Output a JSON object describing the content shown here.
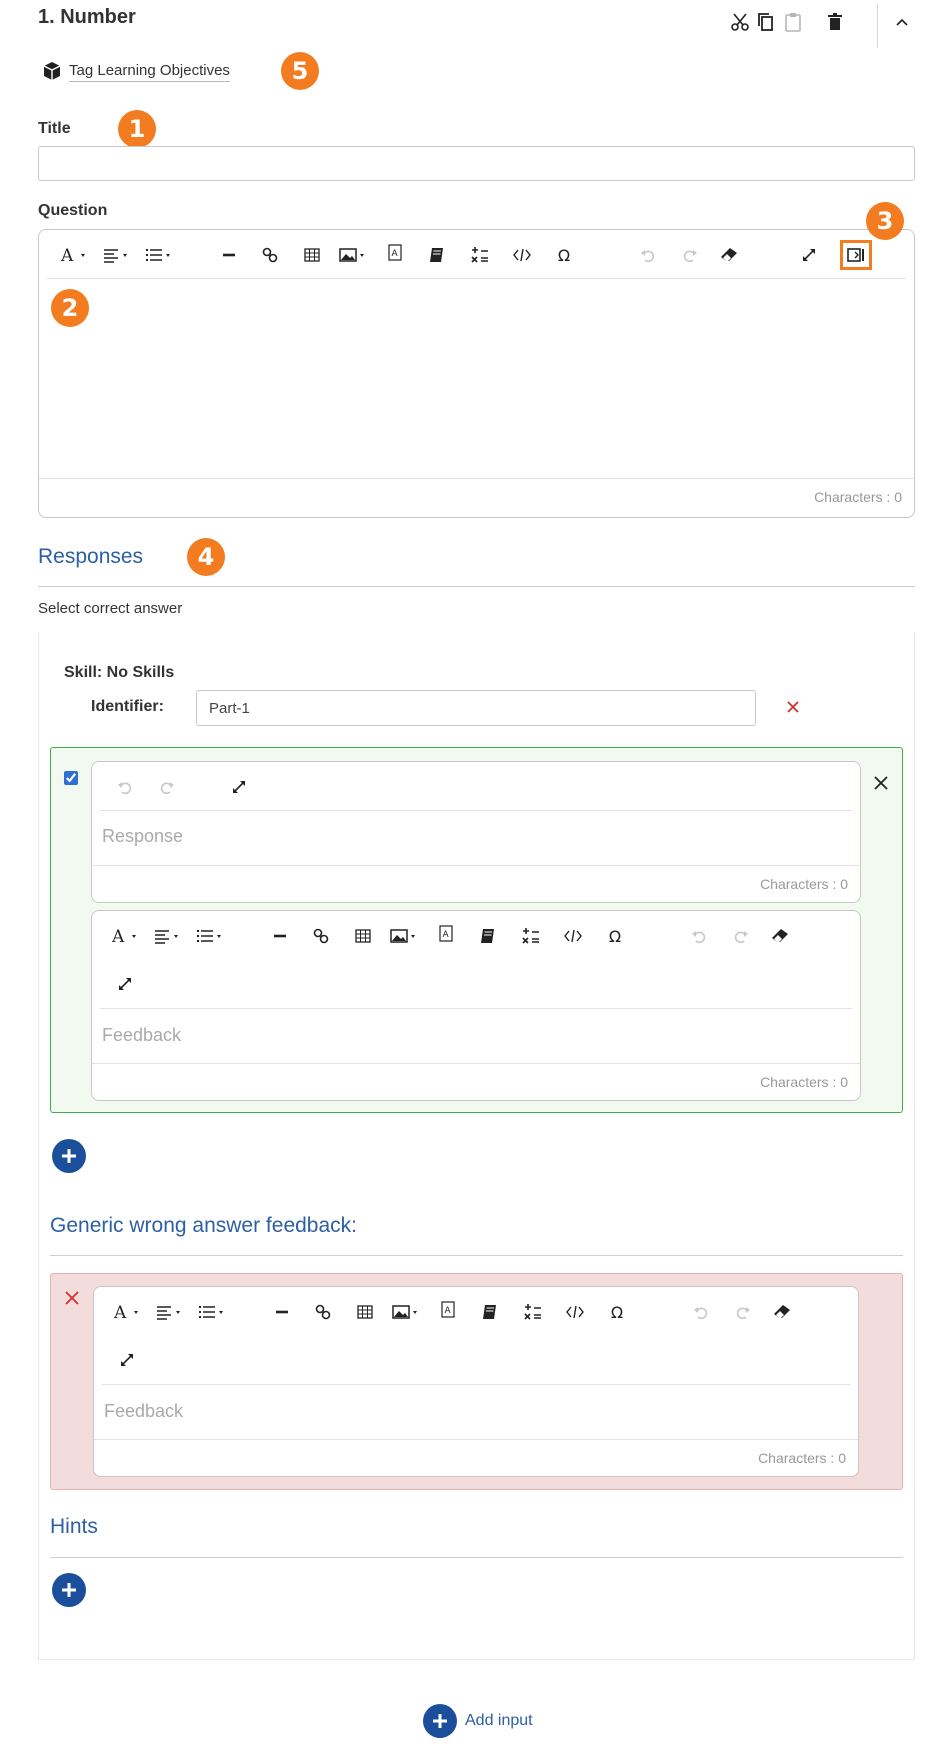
{
  "header": {
    "title": "1. Number",
    "tag_link": "Tag Learning Objectives"
  },
  "badges": [
    "1",
    "2",
    "3",
    "4",
    "5"
  ],
  "title_field": {
    "label": "Title",
    "value": ""
  },
  "question": {
    "label": "Question",
    "characters": "Characters : 0"
  },
  "responses": {
    "heading": "Responses",
    "instruction": "Select correct answer",
    "skill": "Skill: No Skills",
    "identifier_label": "Identifier:",
    "identifier_value": "Part-1",
    "response_placeholder": "Response",
    "response_characters": "Characters : 0",
    "feedback_placeholder": "Feedback",
    "feedback_characters": "Characters : 0",
    "checked": true
  },
  "generic_wrong": {
    "heading": "Generic wrong answer feedback:",
    "feedback_placeholder": "Feedback",
    "feedback_characters": "Characters : 0"
  },
  "hints": {
    "heading": "Hints"
  },
  "footer": {
    "add_input_label": "Add input"
  },
  "colors": {
    "accent_orange": "#f47c20",
    "link_blue": "#2d5fa3",
    "button_blue": "#1b4f9c",
    "correct_bg": "#f1f9f1",
    "correct_border": "#3fae49",
    "wrong_bg": "#f2dcdc",
    "wrong_border": "#e6b3b3",
    "delete_red": "#d0312d"
  },
  "icons": [
    "scissors-icon",
    "copy-icon",
    "paste-icon",
    "trash-icon",
    "chevron-up-icon",
    "cube-icon",
    "font-icon",
    "align-icon",
    "list-icon",
    "horizontal-rule-icon",
    "link-icon",
    "table-icon",
    "image-icon",
    "text-box-icon",
    "book-icon",
    "formula-icon",
    "code-icon",
    "omega-icon",
    "undo-icon",
    "redo-icon",
    "eraser-icon",
    "expand-icon",
    "side-panel-icon",
    "close-icon",
    "plus-icon"
  ]
}
